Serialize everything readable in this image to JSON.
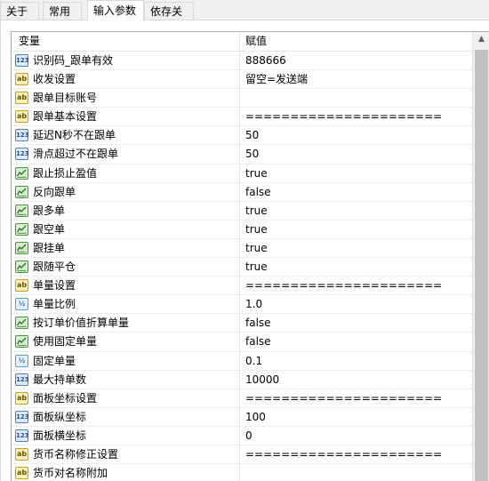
{
  "tabs": [
    {
      "label": "关于"
    },
    {
      "label": "常用"
    },
    {
      "label": "输入参数"
    },
    {
      "label": "依存关系"
    }
  ],
  "table": {
    "col_name": "变量",
    "col_value": "赋值",
    "rows": [
      {
        "type": "num",
        "icon": "integer-icon",
        "icon_text": "123",
        "name": "识别码_跟单有效",
        "value": "888666"
      },
      {
        "type": "str",
        "icon": "string-icon",
        "icon_text": "ab",
        "name": "收发设置",
        "value": "留空=发送端"
      },
      {
        "type": "str",
        "icon": "string-icon",
        "icon_text": "ab",
        "name": "跟单目标账号",
        "value": ""
      },
      {
        "type": "str",
        "icon": "string-icon",
        "icon_text": "ab",
        "name": "跟单基本设置",
        "value": "======================"
      },
      {
        "type": "num",
        "icon": "integer-icon",
        "icon_text": "123",
        "name": "延迟N秒不在跟单",
        "value": "50"
      },
      {
        "type": "num",
        "icon": "integer-icon",
        "icon_text": "123",
        "name": "滑点超过不在跟单",
        "value": "50"
      },
      {
        "type": "bool",
        "icon": "boolean-icon",
        "icon_text": "",
        "name": "跟止损止盈值",
        "value": "true"
      },
      {
        "type": "bool",
        "icon": "boolean-icon",
        "icon_text": "",
        "name": "反向跟单",
        "value": "false"
      },
      {
        "type": "bool",
        "icon": "boolean-icon",
        "icon_text": "",
        "name": "跟多单",
        "value": "true"
      },
      {
        "type": "bool",
        "icon": "boolean-icon",
        "icon_text": "",
        "name": "跟空单",
        "value": "true"
      },
      {
        "type": "bool",
        "icon": "boolean-icon",
        "icon_text": "",
        "name": "跟挂单",
        "value": "true"
      },
      {
        "type": "bool",
        "icon": "boolean-icon",
        "icon_text": "",
        "name": "跟随平仓",
        "value": "true"
      },
      {
        "type": "str",
        "icon": "string-icon",
        "icon_text": "ab",
        "name": "单量设置",
        "value": "======================"
      },
      {
        "type": "dbl",
        "icon": "double-icon",
        "icon_text": "½",
        "name": "单量比例",
        "value": "1.0"
      },
      {
        "type": "bool",
        "icon": "boolean-icon",
        "icon_text": "",
        "name": "按订单价值折算单量",
        "value": "false"
      },
      {
        "type": "bool",
        "icon": "boolean-icon",
        "icon_text": "",
        "name": "使用固定单量",
        "value": "false"
      },
      {
        "type": "dbl",
        "icon": "double-icon",
        "icon_text": "½",
        "name": "固定单量",
        "value": "0.1"
      },
      {
        "type": "num",
        "icon": "integer-icon",
        "icon_text": "123",
        "name": "最大持单数",
        "value": "10000"
      },
      {
        "type": "str",
        "icon": "string-icon",
        "icon_text": "ab",
        "name": "面板坐标设置",
        "value": "======================"
      },
      {
        "type": "num",
        "icon": "integer-icon",
        "icon_text": "123",
        "name": "面板纵坐标",
        "value": "100"
      },
      {
        "type": "num",
        "icon": "integer-icon",
        "icon_text": "123",
        "name": "面板横坐标",
        "value": "0"
      },
      {
        "type": "str",
        "icon": "string-icon",
        "icon_text": "ab",
        "name": "货币名称修正设置",
        "value": "======================"
      },
      {
        "type": "str",
        "icon": "string-icon",
        "icon_text": "ab",
        "name": "货币对名称附加",
        "value": ""
      }
    ]
  },
  "scrollbar": {
    "up_arrow": "▲"
  }
}
